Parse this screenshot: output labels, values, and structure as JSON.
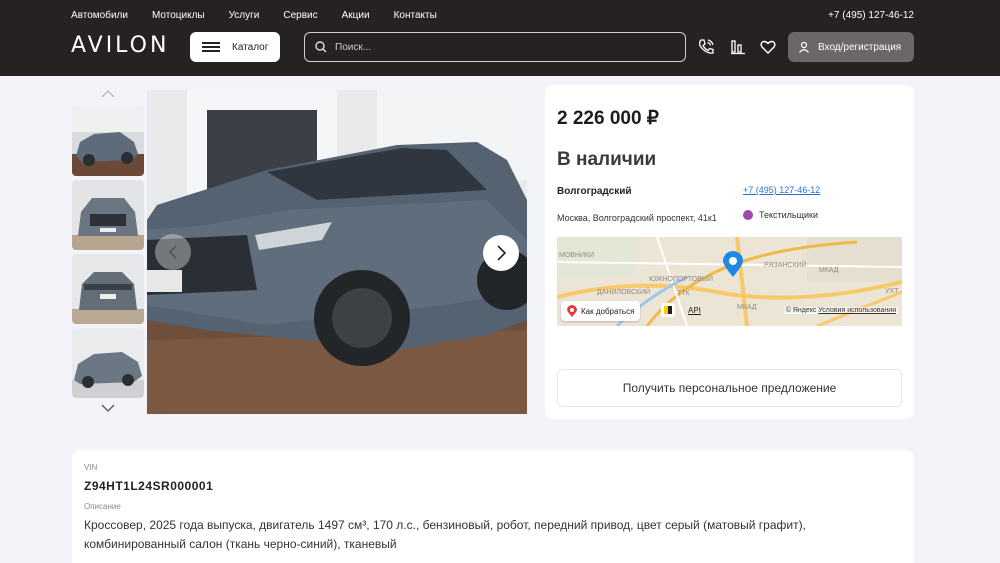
{
  "header": {
    "nav": [
      "Автомобили",
      "Мотоциклы",
      "Услуги",
      "Сервис",
      "Акции",
      "Контакты"
    ],
    "phone": "+7 (495) 127-46-12",
    "logo": "AVILON",
    "catalog_label": "Каталог",
    "search_placeholder": "Поиск...",
    "login_label": "Вход/регистрация"
  },
  "offer": {
    "price": "2 226 000 ₽",
    "availability": "В наличии",
    "dealer_name": "Волгоградский",
    "dealer_phone": "+7 (495) 127-46-12",
    "address": "Москва, Волгоградский проспект, 41к1",
    "metro": "Текстильщики",
    "cta_label": "Получить персональное предложение"
  },
  "map": {
    "route_label": "Как добраться",
    "api_label": "API",
    "copyright": "© Яндекс",
    "terms_link": "Условия использования",
    "labels": [
      "МОВНИКИ",
      "РЯЗАНСКИЙ",
      "МКАД",
      "ЮЖНОПОРТОВЫЙ",
      "ДАНИЛОВСКИЙ",
      "ТТК",
      "МКАД",
      "УХТ"
    ]
  },
  "details": {
    "vin_label": "VIN",
    "vin": "Z94HT1L24SR000001",
    "description_label": "Описание",
    "description": "Кроссовер, 2025 года выпуска, двигатель 1497 см³, 170 л.с., бензиновый, робот, передний привод, цвет серый (матовый графит), комбинированный салон (ткань черно-синий), тканевый"
  },
  "colors": {
    "header_bg": "#262222",
    "page_bg": "#f3f4f9",
    "link": "#2d6fd6",
    "metro_line": "#9b4ca8",
    "map_pin": "#1e88e5"
  }
}
